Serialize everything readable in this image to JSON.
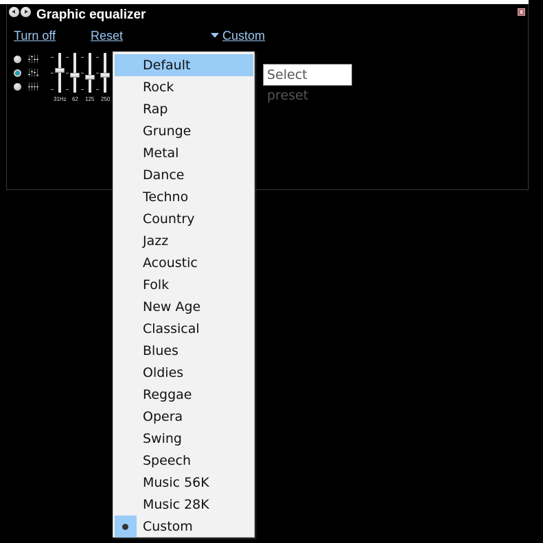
{
  "window": {
    "title": "Graphic equalizer",
    "nav": {
      "back_icon": "back-arrow-icon",
      "forward_icon": "forward-arrow-icon"
    },
    "close_glyph": "x"
  },
  "toolbar": {
    "turn_off_label": "Turn off",
    "reset_label": "Reset",
    "preset_label": "Custom"
  },
  "modes": [
    {
      "name": "mode-1",
      "checked": false
    },
    {
      "name": "mode-2",
      "checked": true
    },
    {
      "name": "mode-3",
      "checked": false
    }
  ],
  "sliders": [
    {
      "label": "31Hz",
      "level": 0.57
    },
    {
      "label": "62",
      "level": 0.44
    },
    {
      "label": "125",
      "level": 0.38
    },
    {
      "label": "250",
      "level": 0.44
    }
  ],
  "preset_menu": {
    "items": [
      {
        "label": "Default",
        "highlighted": true,
        "checked": false
      },
      {
        "label": "Rock",
        "highlighted": false,
        "checked": false
      },
      {
        "label": "Rap",
        "highlighted": false,
        "checked": false
      },
      {
        "label": "Grunge",
        "highlighted": false,
        "checked": false
      },
      {
        "label": "Metal",
        "highlighted": false,
        "checked": false
      },
      {
        "label": "Dance",
        "highlighted": false,
        "checked": false
      },
      {
        "label": "Techno",
        "highlighted": false,
        "checked": false
      },
      {
        "label": "Country",
        "highlighted": false,
        "checked": false
      },
      {
        "label": "Jazz",
        "highlighted": false,
        "checked": false
      },
      {
        "label": "Acoustic",
        "highlighted": false,
        "checked": false
      },
      {
        "label": "Folk",
        "highlighted": false,
        "checked": false
      },
      {
        "label": "New Age",
        "highlighted": false,
        "checked": false
      },
      {
        "label": "Classical",
        "highlighted": false,
        "checked": false
      },
      {
        "label": "Blues",
        "highlighted": false,
        "checked": false
      },
      {
        "label": "Oldies",
        "highlighted": false,
        "checked": false
      },
      {
        "label": "Reggae",
        "highlighted": false,
        "checked": false
      },
      {
        "label": "Opera",
        "highlighted": false,
        "checked": false
      },
      {
        "label": "Swing",
        "highlighted": false,
        "checked": false
      },
      {
        "label": "Speech",
        "highlighted": false,
        "checked": false
      },
      {
        "label": "Music 56K",
        "highlighted": false,
        "checked": false
      },
      {
        "label": "Music 28K",
        "highlighted": false,
        "checked": false
      },
      {
        "label": "Custom",
        "highlighted": false,
        "checked": true
      }
    ]
  },
  "tooltip": {
    "text": "Select preset"
  },
  "colors": {
    "link": "#9cc8f5",
    "menu_highlight": "#99ccf7",
    "menu_bg": "#f2f2f2"
  }
}
